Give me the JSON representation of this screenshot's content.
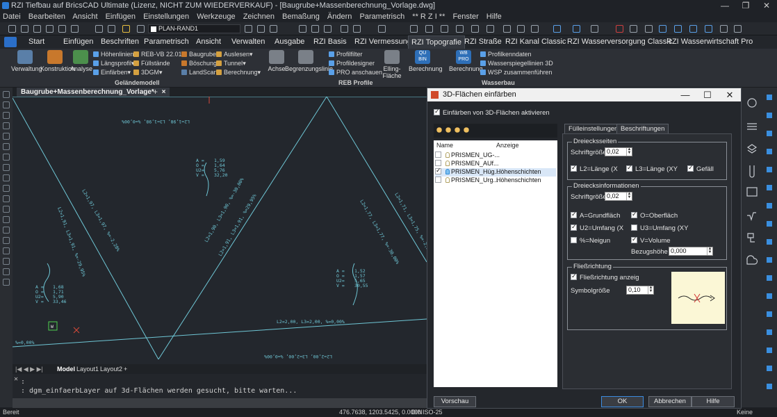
{
  "window": {
    "title": "RZI Tiefbau auf BricsCAD Ultimate (Lizenz, NICHT ZUM WIEDERVERKAUF) - [Baugrube+Massenberechnung_Vorlage.dwg]",
    "controls": [
      "—",
      "❐",
      "✕"
    ]
  },
  "menubar": [
    "Datei",
    "Bearbeiten",
    "Ansicht",
    "Einfügen",
    "Einstellungen",
    "Werkzeuge",
    "Zeichnen",
    "Bemaßung",
    "Ändern",
    "Parametrisch",
    "** R Z I **",
    "Fenster",
    "Hilfe"
  ],
  "toolbar": {
    "layer_name": "PLAN-RAND1"
  },
  "ribbon_tabs": [
    "Start",
    "Einfügen",
    "Beschriften",
    "Parametrisch",
    "Ansicht",
    "Verwalten",
    "Ausgabe",
    "RZI Basis",
    "RZI Vermessung",
    "RZI Topografie",
    "RZI Straße",
    "RZI Kanal Classic",
    "RZI Wasserversorgung Classic",
    "RZI Wasserwirtschaft Pro"
  ],
  "ribbon": {
    "big_buttons": [
      "Verwaltung",
      "Konstruktion",
      "Analyse",
      "Achse",
      "Begrenzungslinie",
      "Elling-Fläche",
      "Berechnung",
      "Berechnung"
    ],
    "gelaende_small": [
      "Höhenlinien",
      "Längsprofil",
      "Einfärben",
      "REB-VB 22.013",
      "Füllstände",
      "3DGM",
      "Baugrube",
      "Böschung",
      "LandScan",
      "Auslesen",
      "Tunnel",
      "Berechnung"
    ],
    "reb_small": [
      "Profilfilter",
      "Profildesigner",
      "PRO anschauen"
    ],
    "wasser_small": [
      "Profilkenndaten",
      "Wasserspiegellinien 3D",
      "WSP zusammenführen"
    ],
    "wasser_icon_text": "WB PRO",
    "bin_icon_text": "QU BIN",
    "group_labels": [
      "Geländemodell",
      "REB Profile",
      "Wasserbau"
    ]
  },
  "document": {
    "tab_label": "Baugrube+Massenberechnung_Vorlage*",
    "tab_close": "×",
    "tab_add": "+"
  },
  "canvas": {
    "labels": {
      "top": "L2=1,98, L3=1,98, %=0,00%",
      "mid_block": [
        "A =",
        "O =",
        "U2=",
        "V ="
      ],
      "mid_vals": [
        "1,59",
        "1,64",
        "5,76",
        "32,20"
      ],
      "left_block_vals": [
        "1,68",
        "1,71",
        "5,90",
        "33,46"
      ],
      "right_block_vals": [
        "1,52",
        "1,57",
        "5,65",
        "30,55"
      ],
      "diag1": "L2=1,97, L3=1,97, %=-2,28%",
      "diag2": "L2=1,91, L3=1,91, %=-29,95%",
      "diag3": "L2=1,90, L3=1,90, %=-30,00%",
      "diag4": "L2=1,91, L3=1,91, %=29,95%",
      "diag5": "L2=1,77, L3=1,77, %=-30,00%",
      "diag6": "L2=1,71, L3=1,75, %=-2,24%",
      "bottom1": "L2=2,00, L3=2,00, %=0,00%",
      "bottom2": "L2=2,00, L3=2,00, %=0,00%",
      "left_pct": "%=0,00%",
      "ucs": "W"
    }
  },
  "layout_tabs": [
    "Model",
    "Layout1",
    "Layout2",
    "+"
  ],
  "command": {
    "line1": ":",
    "line2": ": dgm_einfaerbLayer auf 3d-Flächen werden gesucht, bitte warten..."
  },
  "status": {
    "left": "Bereit",
    "coords": "476.7638, 1203.5425, 0.0000",
    "items": [
      "DIN",
      "ISO-25"
    ],
    "right": "Keine"
  },
  "dialog": {
    "title": "3D-Flächen einfärben",
    "enable_label": "Einfärben von 3D-Flächen aktivieren",
    "list_headers": [
      "Name",
      "Anzeige"
    ],
    "layers": [
      {
        "name": "PRISMEN_UG-...",
        "display": "",
        "checked": false,
        "selected": false
      },
      {
        "name": "PRISMEN_AUf...",
        "display": "",
        "checked": false,
        "selected": false
      },
      {
        "name": "PRISMEN_Hüg...",
        "display": "Höhenschichten",
        "checked": true,
        "selected": true
      },
      {
        "name": "PRISMEN_Urg...",
        "display": "Höhenschichten",
        "checked": false,
        "selected": false
      }
    ],
    "tabs": [
      "Fülleinstellungen",
      "Beschriftungen"
    ],
    "dreieck": {
      "title": "Dreiecksseiten",
      "font_label": "Schriftgröße",
      "font_value": "0,02",
      "checks": [
        "L2=Länge (X",
        "L3=Länge (XY",
        "Gefäll"
      ]
    },
    "info": {
      "title": "Dreiecksinformationen",
      "font_label": "Schriftgröße",
      "font_value": "0,02",
      "checks": [
        "A=Grundfläch",
        "O=Oberfläch",
        "U2=Umfang (X",
        "U3=Umfang (XY",
        "%=Neigun",
        "V=Volume"
      ],
      "bezug_label": "Bezugshöhe",
      "bezug_value": "0,000"
    },
    "fluss": {
      "title": "Fließrichtung",
      "check": "Fließrichtung anzeig",
      "symbol_label": "Symbolgröße",
      "symbol_value": "0,10"
    },
    "buttons": [
      "Vorschau",
      "OK",
      "Abbrechen",
      "Hilfe"
    ]
  }
}
